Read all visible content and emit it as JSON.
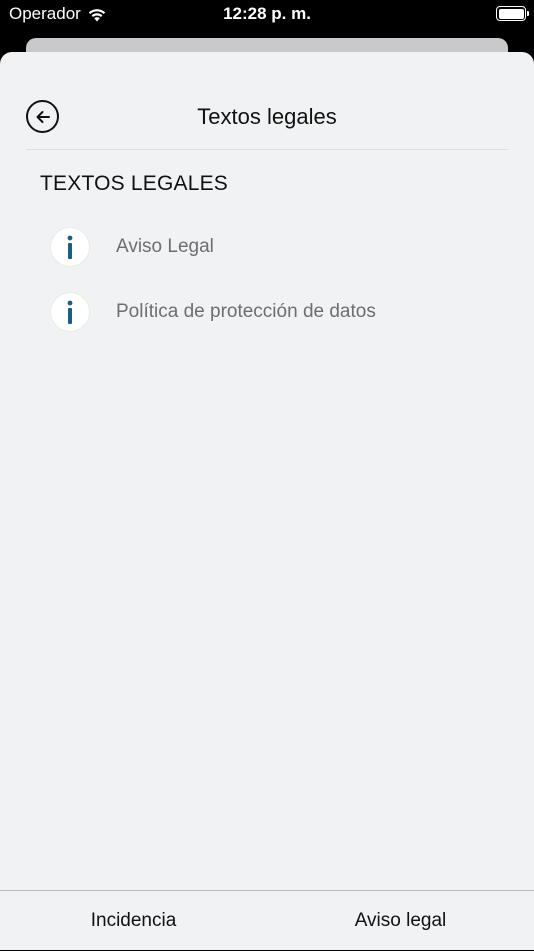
{
  "status_bar": {
    "carrier": "Operador",
    "time": "12:28 p. m."
  },
  "header": {
    "title": "Textos legales"
  },
  "section": {
    "title": "TEXTOS LEGALES",
    "items": [
      {
        "label": "Aviso Legal",
        "icon": "info-icon"
      },
      {
        "label": "Política de protección de datos",
        "icon": "info-icon"
      }
    ]
  },
  "bottom_bar": {
    "left_label": "Incidencia",
    "right_label": "Aviso legal"
  },
  "colors": {
    "sheet_background": "#f1f2f4",
    "info_icon": "#1a5e86",
    "item_text": "#6e6e72"
  }
}
